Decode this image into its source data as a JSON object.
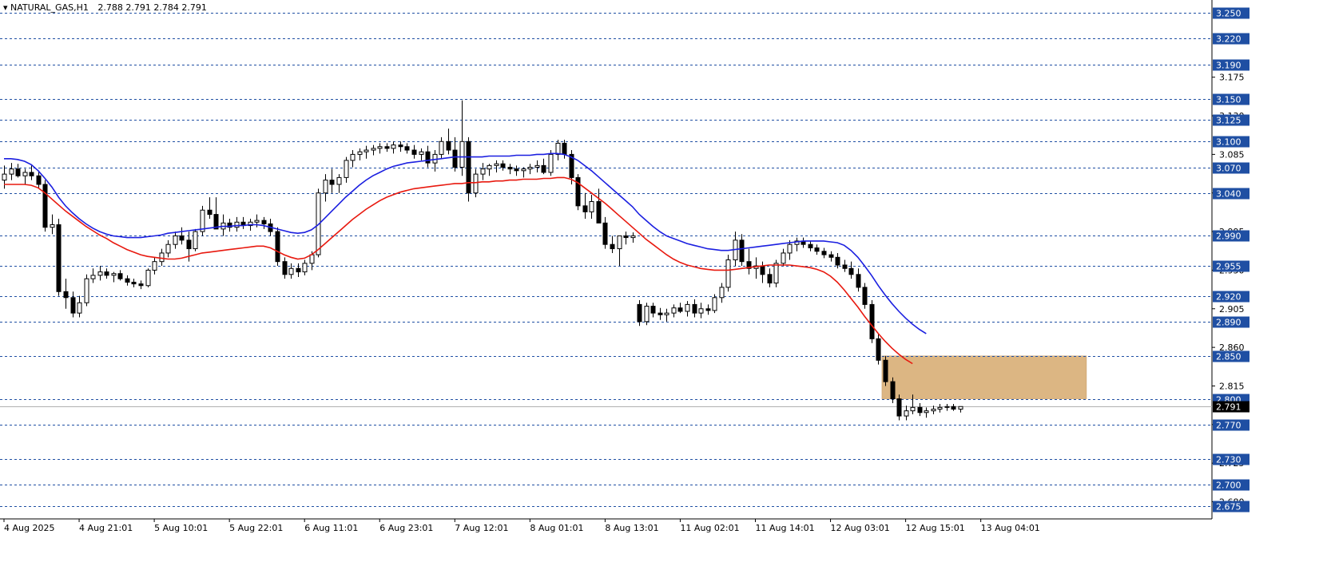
{
  "header": {
    "symbol": "NATURAL_GAS,H1",
    "open": "2.788",
    "high": "2.791",
    "low": "2.784",
    "close": "2.791"
  },
  "colors": {
    "background": "#ffffff",
    "level_line": "#1f4fa3",
    "level_label_bg": "#1f4fa3",
    "level_label_text": "#ffffff",
    "current_label_bg": "#000000",
    "current_label_text": "#ffffff",
    "current_line": "#b0b0b0",
    "ma_slow": "#e8190f",
    "ma_fast": "#1b1fe0",
    "zone_fill": "#dcb683",
    "bull_body": "#ffffff",
    "bear_body": "#000000"
  },
  "chart_data": {
    "type": "candlestick",
    "ylim": [
      2.66,
      3.265
    ],
    "price_scale_ticks": [
      "3.175",
      "3.130",
      "3.085",
      "3.040",
      "2.995",
      "2.950",
      "2.905",
      "2.860",
      "2.815",
      "2.770",
      "2.725",
      "2.680"
    ],
    "horizontal_levels": [
      3.25,
      3.22,
      3.19,
      3.15,
      3.125,
      3.1,
      3.07,
      3.04,
      2.99,
      2.955,
      2.92,
      2.89,
      2.85,
      2.8,
      2.77,
      2.73,
      2.7,
      2.675
    ],
    "current_price": 2.791,
    "zone": {
      "price_low": 2.8,
      "price_high": 2.85,
      "start_candle": 129,
      "end_candle": 158
    },
    "x_tick_labels": [
      {
        "label": "4 Aug 2025",
        "index": 0
      },
      {
        "label": "4 Aug 21:01",
        "index": 11
      },
      {
        "label": "5 Aug 10:01",
        "index": 22
      },
      {
        "label": "5 Aug 22:01",
        "index": 33
      },
      {
        "label": "6 Aug 11:01",
        "index": 44
      },
      {
        "label": "6 Aug 23:01",
        "index": 55
      },
      {
        "label": "7 Aug 12:01",
        "index": 66
      },
      {
        "label": "8 Aug 01:01",
        "index": 77
      },
      {
        "label": "8 Aug 13:01",
        "index": 88
      },
      {
        "label": "11 Aug 02:01",
        "index": 99
      },
      {
        "label": "11 Aug 14:01",
        "index": 110
      },
      {
        "label": "12 Aug 03:01",
        "index": 121
      },
      {
        "label": "12 Aug 15:01",
        "index": 132
      },
      {
        "label": "13 Aug 04:01",
        "index": 143
      }
    ],
    "ohlc": [
      [
        3.055,
        3.072,
        3.045,
        3.062
      ],
      [
        3.062,
        3.075,
        3.055,
        3.068
      ],
      [
        3.068,
        3.074,
        3.058,
        3.06
      ],
      [
        3.06,
        3.068,
        3.05,
        3.064
      ],
      [
        3.064,
        3.072,
        3.055,
        3.06
      ],
      [
        3.06,
        3.066,
        3.045,
        3.05
      ],
      [
        3.05,
        3.055,
        2.995,
        3.0
      ],
      [
        3.0,
        3.015,
        2.992,
        3.003
      ],
      [
        3.003,
        3.01,
        2.92,
        2.925
      ],
      [
        2.925,
        2.94,
        2.905,
        2.918
      ],
      [
        2.918,
        2.925,
        2.895,
        2.9
      ],
      [
        2.9,
        2.92,
        2.895,
        2.912
      ],
      [
        2.912,
        2.945,
        2.908,
        2.94
      ],
      [
        2.94,
        2.952,
        2.935,
        2.944
      ],
      [
        2.944,
        2.955,
        2.938,
        2.948
      ],
      [
        2.948,
        2.952,
        2.94,
        2.944
      ],
      [
        2.944,
        2.948,
        2.936,
        2.946
      ],
      [
        2.946,
        2.95,
        2.938,
        2.94
      ],
      [
        2.94,
        2.944,
        2.932,
        2.936
      ],
      [
        2.936,
        2.94,
        2.93,
        2.934
      ],
      [
        2.934,
        2.938,
        2.928,
        2.932
      ],
      [
        2.932,
        2.952,
        2.93,
        2.95
      ],
      [
        2.95,
        2.965,
        2.945,
        2.96
      ],
      [
        2.96,
        2.975,
        2.955,
        2.97
      ],
      [
        2.97,
        2.985,
        2.965,
        2.98
      ],
      [
        2.98,
        2.995,
        2.975,
        2.99
      ],
      [
        2.99,
        3.0,
        2.98,
        2.985
      ],
      [
        2.985,
        2.995,
        2.96,
        2.975
      ],
      [
        2.975,
        2.998,
        2.972,
        2.995
      ],
      [
        2.995,
        3.025,
        2.99,
        3.02
      ],
      [
        3.02,
        3.035,
        3.01,
        3.015
      ],
      [
        3.015,
        3.035,
        3.0,
        2.998
      ],
      [
        2.998,
        3.015,
        2.99,
        3.005
      ],
      [
        3.005,
        3.01,
        2.995,
        3.0
      ],
      [
        3.0,
        3.012,
        2.995,
        3.006
      ],
      [
        3.006,
        3.012,
        2.998,
        3.002
      ],
      [
        3.002,
        3.01,
        2.996,
        3.006
      ],
      [
        3.006,
        3.015,
        3.0,
        3.008
      ],
      [
        3.008,
        3.012,
        2.998,
        3.004
      ],
      [
        3.004,
        3.01,
        2.99,
        2.995
      ],
      [
        2.995,
        3.0,
        2.955,
        2.96
      ],
      [
        2.96,
        2.965,
        2.94,
        2.945
      ],
      [
        2.945,
        2.958,
        2.94,
        2.952
      ],
      [
        2.952,
        2.958,
        2.942,
        2.948
      ],
      [
        2.948,
        2.962,
        2.944,
        2.958
      ],
      [
        2.958,
        2.972,
        2.95,
        2.968
      ],
      [
        2.968,
        3.045,
        2.965,
        3.04
      ],
      [
        3.04,
        3.062,
        3.03,
        3.055
      ],
      [
        3.055,
        3.068,
        3.04,
        3.05
      ],
      [
        3.05,
        3.062,
        3.04,
        3.058
      ],
      [
        3.058,
        3.082,
        3.052,
        3.078
      ],
      [
        3.078,
        3.09,
        3.07,
        3.085
      ],
      [
        3.085,
        3.092,
        3.078,
        3.088
      ],
      [
        3.088,
        3.095,
        3.08,
        3.09
      ],
      [
        3.09,
        3.096,
        3.084,
        3.092
      ],
      [
        3.092,
        3.098,
        3.086,
        3.094
      ],
      [
        3.094,
        3.098,
        3.088,
        3.092
      ],
      [
        3.092,
        3.1,
        3.086,
        3.096
      ],
      [
        3.096,
        3.1,
        3.088,
        3.094
      ],
      [
        3.094,
        3.098,
        3.086,
        3.09
      ],
      [
        3.09,
        3.096,
        3.08,
        3.085
      ],
      [
        3.085,
        3.092,
        3.078,
        3.088
      ],
      [
        3.088,
        3.095,
        3.07,
        3.075
      ],
      [
        3.075,
        3.09,
        3.065,
        3.085
      ],
      [
        3.085,
        3.105,
        3.08,
        3.1
      ],
      [
        3.1,
        3.115,
        3.085,
        3.09
      ],
      [
        3.09,
        3.105,
        3.065,
        3.07
      ],
      [
        3.07,
        3.148,
        3.06,
        3.1
      ],
      [
        3.1,
        3.105,
        3.03,
        3.04
      ],
      [
        3.04,
        3.068,
        3.035,
        3.062
      ],
      [
        3.062,
        3.075,
        3.055,
        3.068
      ],
      [
        3.068,
        3.074,
        3.06,
        3.072
      ],
      [
        3.072,
        3.078,
        3.064,
        3.074
      ],
      [
        3.074,
        3.078,
        3.066,
        3.07
      ],
      [
        3.07,
        3.074,
        3.062,
        3.068
      ],
      [
        3.068,
        3.072,
        3.06,
        3.066
      ],
      [
        3.066,
        3.07,
        3.058,
        3.068
      ],
      [
        3.068,
        3.074,
        3.062,
        3.07
      ],
      [
        3.07,
        3.078,
        3.064,
        3.072
      ],
      [
        3.072,
        3.08,
        3.062,
        3.064
      ],
      [
        3.064,
        3.09,
        3.06,
        3.085
      ],
      [
        3.085,
        3.102,
        3.078,
        3.098
      ],
      [
        3.098,
        3.102,
        3.08,
        3.085
      ],
      [
        3.085,
        3.09,
        3.05,
        3.058
      ],
      [
        3.058,
        3.062,
        3.02,
        3.025
      ],
      [
        3.025,
        3.04,
        3.01,
        3.018
      ],
      [
        3.018,
        3.038,
        3.01,
        3.03
      ],
      [
        3.03,
        3.045,
        3.01,
        3.005
      ],
      [
        3.005,
        3.012,
        2.975,
        2.98
      ],
      [
        2.98,
        2.99,
        2.97,
        2.975
      ],
      [
        2.975,
        2.985,
        2.955,
        2.99
      ],
      [
        2.99,
        2.995,
        2.98,
        2.988
      ],
      [
        2.988,
        2.994,
        2.982,
        2.99
      ],
      [
        2.91,
        2.915,
        2.885,
        2.89
      ],
      [
        2.89,
        2.912,
        2.886,
        2.908
      ],
      [
        2.908,
        2.912,
        2.895,
        2.9
      ],
      [
        2.9,
        2.906,
        2.892,
        2.898
      ],
      [
        2.898,
        2.905,
        2.89,
        2.9
      ],
      [
        2.9,
        2.91,
        2.895,
        2.906
      ],
      [
        2.906,
        2.912,
        2.9,
        2.902
      ],
      [
        2.902,
        2.914,
        2.896,
        2.91
      ],
      [
        2.91,
        2.916,
        2.895,
        2.9
      ],
      [
        2.9,
        2.912,
        2.894,
        2.905
      ],
      [
        2.905,
        2.91,
        2.898,
        2.903
      ],
      [
        2.903,
        2.922,
        2.9,
        2.918
      ],
      [
        2.918,
        2.935,
        2.912,
        2.93
      ],
      [
        2.93,
        2.968,
        2.925,
        2.962
      ],
      [
        2.962,
        2.995,
        2.955,
        2.985
      ],
      [
        2.985,
        2.992,
        2.955,
        2.96
      ],
      [
        2.96,
        2.975,
        2.945,
        2.952
      ],
      [
        2.952,
        2.965,
        2.94,
        2.955
      ],
      [
        2.955,
        2.96,
        2.935,
        2.945
      ],
      [
        2.945,
        2.952,
        2.93,
        2.935
      ],
      [
        2.935,
        2.962,
        2.93,
        2.958
      ],
      [
        2.958,
        2.975,
        2.955,
        2.97
      ],
      [
        2.97,
        2.985,
        2.962,
        2.98
      ],
      [
        2.98,
        2.988,
        2.972,
        2.984
      ],
      [
        2.984,
        2.988,
        2.976,
        2.98
      ],
      [
        2.98,
        2.984,
        2.972,
        2.976
      ],
      [
        2.976,
        2.98,
        2.968,
        2.972
      ],
      [
        2.972,
        2.976,
        2.964,
        2.968
      ],
      [
        2.968,
        2.972,
        2.96,
        2.965
      ],
      [
        2.965,
        2.97,
        2.952,
        2.956
      ],
      [
        2.956,
        2.962,
        2.948,
        2.952
      ],
      [
        2.952,
        2.96,
        2.94,
        2.945
      ],
      [
        2.945,
        2.952,
        2.925,
        2.93
      ],
      [
        2.93,
        2.935,
        2.905,
        2.91
      ],
      [
        2.91,
        2.915,
        2.865,
        2.87
      ],
      [
        2.87,
        2.875,
        2.84,
        2.845
      ],
      [
        2.845,
        2.85,
        2.815,
        2.82
      ],
      [
        2.82,
        2.825,
        2.795,
        2.8
      ],
      [
        2.8,
        2.805,
        2.775,
        2.78
      ],
      [
        2.78,
        2.792,
        2.775,
        2.786
      ],
      [
        2.786,
        2.805,
        2.782,
        2.79
      ],
      [
        2.79,
        2.795,
        2.78,
        2.784
      ],
      [
        2.784,
        2.79,
        2.778,
        2.786
      ],
      [
        2.786,
        2.792,
        2.782,
        2.788
      ],
      [
        2.788,
        2.794,
        2.784,
        2.79
      ],
      [
        2.79,
        2.794,
        2.786,
        2.791
      ],
      [
        2.791,
        2.794,
        2.786,
        2.788
      ],
      [
        2.788,
        2.791,
        2.784,
        2.791
      ]
    ],
    "series": [
      {
        "name": "",
        "color": "#1b1fe0",
        "values": [
          3.08,
          3.08,
          3.079,
          3.077,
          3.073,
          3.066,
          3.057,
          3.047,
          3.035,
          3.025,
          3.017,
          3.01,
          3.004,
          2.999,
          2.995,
          2.992,
          2.99,
          2.989,
          2.988,
          2.988,
          2.988,
          2.989,
          2.99,
          2.991,
          2.993,
          2.994,
          2.995,
          2.996,
          2.997,
          2.998,
          2.999,
          3.0,
          3.001,
          3.001,
          3.002,
          3.002,
          3.003,
          3.003,
          3.002,
          3.0,
          2.998,
          2.996,
          2.994,
          2.993,
          2.994,
          2.997,
          3.003,
          3.011,
          3.019,
          3.027,
          3.035,
          3.042,
          3.049,
          3.055,
          3.06,
          3.064,
          3.068,
          3.071,
          3.073,
          3.075,
          3.076,
          3.077,
          3.078,
          3.079,
          3.08,
          3.081,
          3.082,
          3.082,
          3.082,
          3.082,
          3.082,
          3.083,
          3.083,
          3.083,
          3.083,
          3.084,
          3.084,
          3.084,
          3.085,
          3.085,
          3.086,
          3.086,
          3.085,
          3.082,
          3.078,
          3.072,
          3.066,
          3.059,
          3.052,
          3.045,
          3.038,
          3.031,
          3.024,
          3.015,
          3.008,
          3.001,
          2.995,
          2.99,
          2.987,
          2.984,
          2.981,
          2.979,
          2.977,
          2.975,
          2.974,
          2.973,
          2.973,
          2.974,
          2.975,
          2.976,
          2.977,
          2.978,
          2.979,
          2.98,
          2.981,
          2.982,
          2.983,
          2.984,
          2.984,
          2.984,
          2.984,
          2.983,
          2.982,
          2.979,
          2.973,
          2.965,
          2.955,
          2.944,
          2.932,
          2.921,
          2.911,
          2.902,
          2.894,
          2.887,
          2.881,
          2.876
        ]
      },
      {
        "name": "",
        "color": "#e8190f",
        "values": [
          3.05,
          3.05,
          3.05,
          3.05,
          3.049,
          3.046,
          3.04,
          3.033,
          3.026,
          3.019,
          3.013,
          3.007,
          3.001,
          2.996,
          2.991,
          2.987,
          2.982,
          2.978,
          2.974,
          2.971,
          2.968,
          2.966,
          2.965,
          2.964,
          2.963,
          2.963,
          2.964,
          2.966,
          2.968,
          2.97,
          2.971,
          2.972,
          2.973,
          2.974,
          2.975,
          2.976,
          2.977,
          2.978,
          2.978,
          2.976,
          2.972,
          2.968,
          2.965,
          2.963,
          2.964,
          2.968,
          2.974,
          2.981,
          2.988,
          2.995,
          3.002,
          3.009,
          3.015,
          3.021,
          3.026,
          3.031,
          3.035,
          3.038,
          3.041,
          3.043,
          3.045,
          3.046,
          3.047,
          3.048,
          3.049,
          3.05,
          3.051,
          3.051,
          3.052,
          3.052,
          3.053,
          3.053,
          3.054,
          3.054,
          3.055,
          3.055,
          3.056,
          3.056,
          3.056,
          3.057,
          3.057,
          3.058,
          3.058,
          3.056,
          3.052,
          3.046,
          3.04,
          3.034,
          3.028,
          3.021,
          3.014,
          3.007,
          3.0,
          2.993,
          2.986,
          2.98,
          2.974,
          2.968,
          2.963,
          2.959,
          2.956,
          2.954,
          2.952,
          2.951,
          2.95,
          2.95,
          2.95,
          2.951,
          2.952,
          2.953,
          2.954,
          2.955,
          2.956,
          2.956,
          2.956,
          2.956,
          2.955,
          2.954,
          2.953,
          2.951,
          2.948,
          2.943,
          2.936,
          2.927,
          2.917,
          2.907,
          2.896,
          2.886,
          2.876,
          2.867,
          2.859,
          2.852,
          2.846,
          2.841
        ]
      }
    ]
  }
}
